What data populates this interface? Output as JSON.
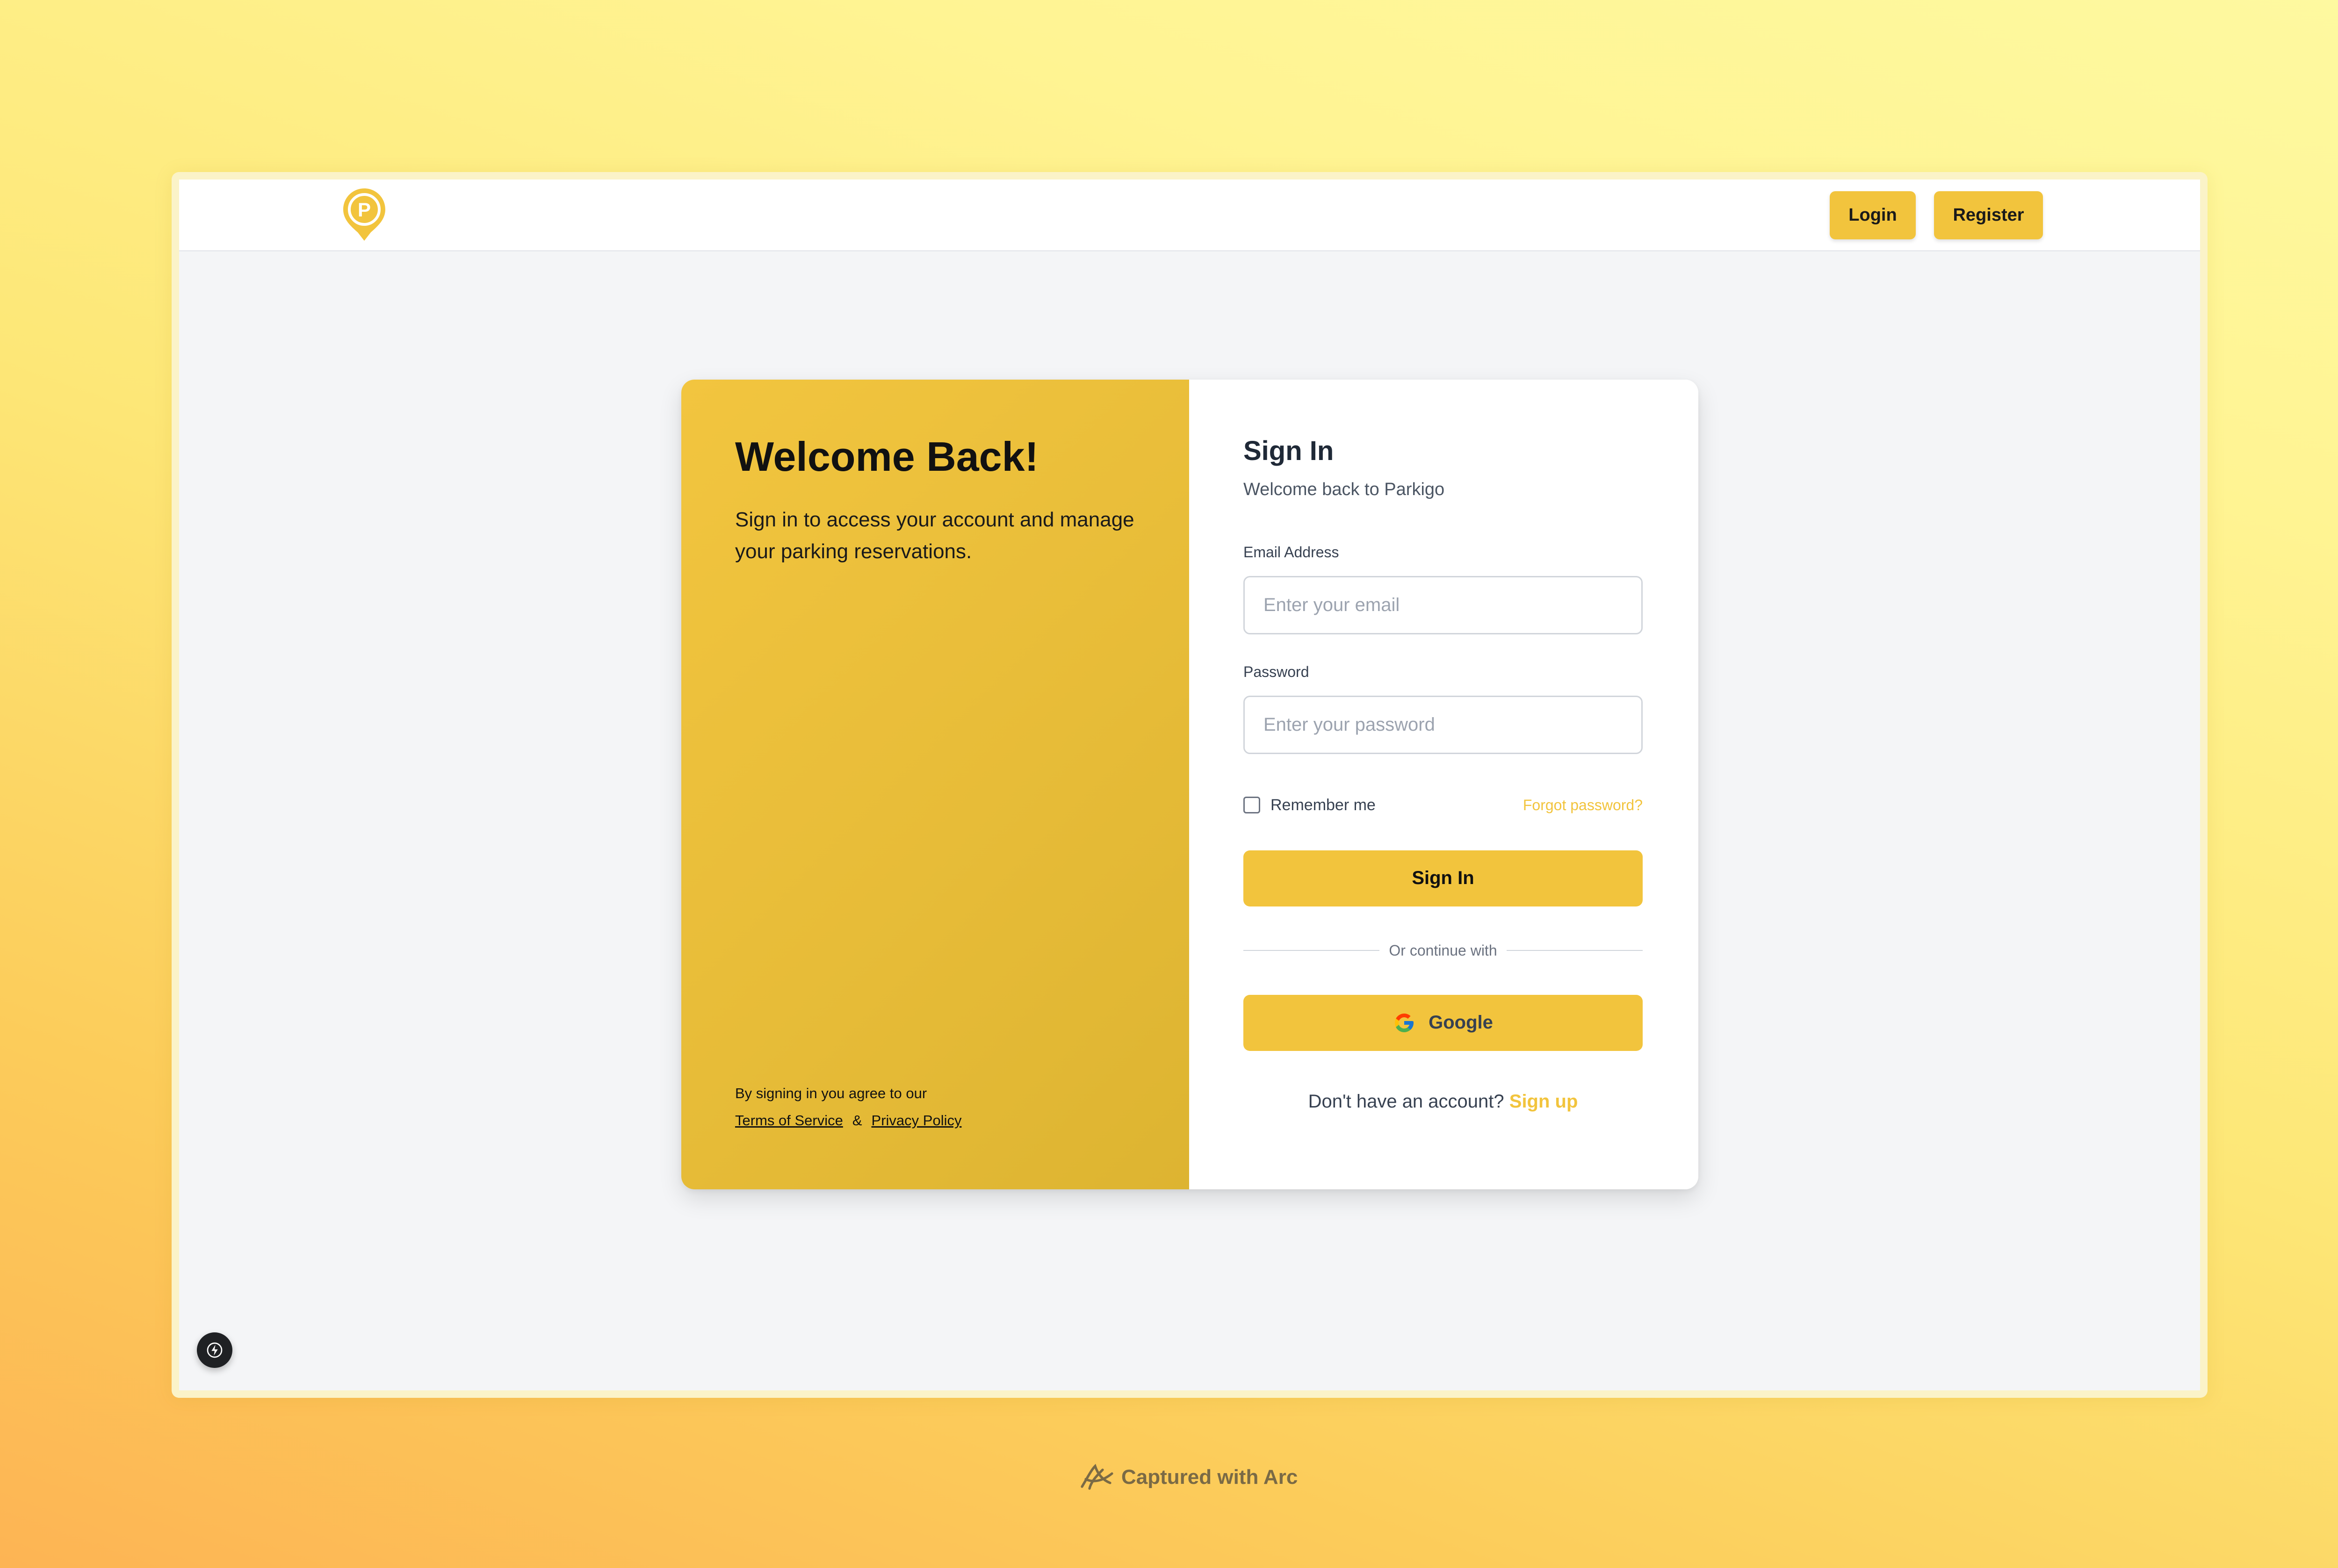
{
  "navbar": {
    "logo_icon": "parking-pin-logo-icon",
    "login_label": "Login",
    "register_label": "Register"
  },
  "welcome": {
    "title": "Welcome Back!",
    "subtitle": "Sign in to access your account and manage your parking reservations.",
    "legal_prefix": "By signing in you agree to our",
    "terms_label": "Terms of Service",
    "ampersand": "&",
    "privacy_label": "Privacy Policy"
  },
  "form": {
    "title": "Sign In",
    "subtitle": "Welcome back to Parkigo",
    "email_label": "Email Address",
    "email_placeholder": "Enter your email",
    "password_label": "Password",
    "password_placeholder": "Enter your password",
    "remember_label": "Remember me",
    "remember_checked": false,
    "forgot_label": "Forgot password?",
    "submit_label": "Sign In",
    "divider_text": "Or continue with",
    "google_label": "Google",
    "signup_prompt": "Don't have an account?",
    "signup_label": "Sign up"
  },
  "footer": {
    "caption": "Captured with Arc"
  },
  "colors": {
    "accent": "#f2c43d",
    "panel": "#e7bc38",
    "text_dark": "#111111"
  }
}
